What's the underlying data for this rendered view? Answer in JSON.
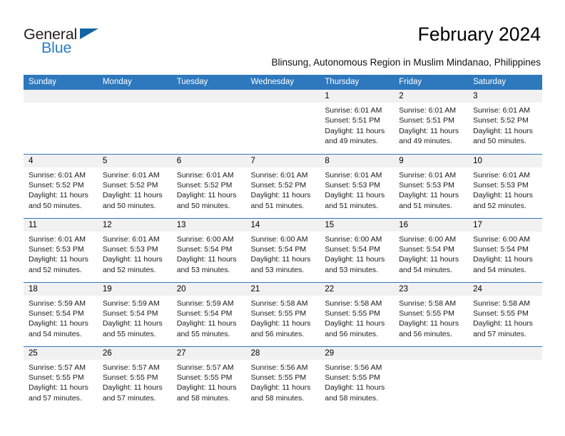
{
  "brand": {
    "logo_top": "General",
    "logo_bottom": "Blue",
    "logo_triangle_icon": "triangle-icon",
    "accent_color": "#2e78bd",
    "logo_blue_color": "#2b7cc4"
  },
  "header": {
    "title": "February 2024",
    "location": "Blinsung, Autonomous Region in Muslim Mindanao, Philippines"
  },
  "weekday_headers": [
    "Sunday",
    "Monday",
    "Tuesday",
    "Wednesday",
    "Thursday",
    "Friday",
    "Saturday"
  ],
  "weeks": [
    [
      {
        "day": "",
        "sunrise": "",
        "sunset": "",
        "daylight_line1": "",
        "daylight_line2": ""
      },
      {
        "day": "",
        "sunrise": "",
        "sunset": "",
        "daylight_line1": "",
        "daylight_line2": ""
      },
      {
        "day": "",
        "sunrise": "",
        "sunset": "",
        "daylight_line1": "",
        "daylight_line2": ""
      },
      {
        "day": "",
        "sunrise": "",
        "sunset": "",
        "daylight_line1": "",
        "daylight_line2": ""
      },
      {
        "day": "1",
        "sunrise": "Sunrise: 6:01 AM",
        "sunset": "Sunset: 5:51 PM",
        "daylight_line1": "Daylight: 11 hours",
        "daylight_line2": "and 49 minutes."
      },
      {
        "day": "2",
        "sunrise": "Sunrise: 6:01 AM",
        "sunset": "Sunset: 5:51 PM",
        "daylight_line1": "Daylight: 11 hours",
        "daylight_line2": "and 49 minutes."
      },
      {
        "day": "3",
        "sunrise": "Sunrise: 6:01 AM",
        "sunset": "Sunset: 5:52 PM",
        "daylight_line1": "Daylight: 11 hours",
        "daylight_line2": "and 50 minutes."
      }
    ],
    [
      {
        "day": "4",
        "sunrise": "Sunrise: 6:01 AM",
        "sunset": "Sunset: 5:52 PM",
        "daylight_line1": "Daylight: 11 hours",
        "daylight_line2": "and 50 minutes."
      },
      {
        "day": "5",
        "sunrise": "Sunrise: 6:01 AM",
        "sunset": "Sunset: 5:52 PM",
        "daylight_line1": "Daylight: 11 hours",
        "daylight_line2": "and 50 minutes."
      },
      {
        "day": "6",
        "sunrise": "Sunrise: 6:01 AM",
        "sunset": "Sunset: 5:52 PM",
        "daylight_line1": "Daylight: 11 hours",
        "daylight_line2": "and 50 minutes."
      },
      {
        "day": "7",
        "sunrise": "Sunrise: 6:01 AM",
        "sunset": "Sunset: 5:52 PM",
        "daylight_line1": "Daylight: 11 hours",
        "daylight_line2": "and 51 minutes."
      },
      {
        "day": "8",
        "sunrise": "Sunrise: 6:01 AM",
        "sunset": "Sunset: 5:53 PM",
        "daylight_line1": "Daylight: 11 hours",
        "daylight_line2": "and 51 minutes."
      },
      {
        "day": "9",
        "sunrise": "Sunrise: 6:01 AM",
        "sunset": "Sunset: 5:53 PM",
        "daylight_line1": "Daylight: 11 hours",
        "daylight_line2": "and 51 minutes."
      },
      {
        "day": "10",
        "sunrise": "Sunrise: 6:01 AM",
        "sunset": "Sunset: 5:53 PM",
        "daylight_line1": "Daylight: 11 hours",
        "daylight_line2": "and 52 minutes."
      }
    ],
    [
      {
        "day": "11",
        "sunrise": "Sunrise: 6:01 AM",
        "sunset": "Sunset: 5:53 PM",
        "daylight_line1": "Daylight: 11 hours",
        "daylight_line2": "and 52 minutes."
      },
      {
        "day": "12",
        "sunrise": "Sunrise: 6:01 AM",
        "sunset": "Sunset: 5:53 PM",
        "daylight_line1": "Daylight: 11 hours",
        "daylight_line2": "and 52 minutes."
      },
      {
        "day": "13",
        "sunrise": "Sunrise: 6:00 AM",
        "sunset": "Sunset: 5:54 PM",
        "daylight_line1": "Daylight: 11 hours",
        "daylight_line2": "and 53 minutes."
      },
      {
        "day": "14",
        "sunrise": "Sunrise: 6:00 AM",
        "sunset": "Sunset: 5:54 PM",
        "daylight_line1": "Daylight: 11 hours",
        "daylight_line2": "and 53 minutes."
      },
      {
        "day": "15",
        "sunrise": "Sunrise: 6:00 AM",
        "sunset": "Sunset: 5:54 PM",
        "daylight_line1": "Daylight: 11 hours",
        "daylight_line2": "and 53 minutes."
      },
      {
        "day": "16",
        "sunrise": "Sunrise: 6:00 AM",
        "sunset": "Sunset: 5:54 PM",
        "daylight_line1": "Daylight: 11 hours",
        "daylight_line2": "and 54 minutes."
      },
      {
        "day": "17",
        "sunrise": "Sunrise: 6:00 AM",
        "sunset": "Sunset: 5:54 PM",
        "daylight_line1": "Daylight: 11 hours",
        "daylight_line2": "and 54 minutes."
      }
    ],
    [
      {
        "day": "18",
        "sunrise": "Sunrise: 5:59 AM",
        "sunset": "Sunset: 5:54 PM",
        "daylight_line1": "Daylight: 11 hours",
        "daylight_line2": "and 54 minutes."
      },
      {
        "day": "19",
        "sunrise": "Sunrise: 5:59 AM",
        "sunset": "Sunset: 5:54 PM",
        "daylight_line1": "Daylight: 11 hours",
        "daylight_line2": "and 55 minutes."
      },
      {
        "day": "20",
        "sunrise": "Sunrise: 5:59 AM",
        "sunset": "Sunset: 5:54 PM",
        "daylight_line1": "Daylight: 11 hours",
        "daylight_line2": "and 55 minutes."
      },
      {
        "day": "21",
        "sunrise": "Sunrise: 5:58 AM",
        "sunset": "Sunset: 5:55 PM",
        "daylight_line1": "Daylight: 11 hours",
        "daylight_line2": "and 56 minutes."
      },
      {
        "day": "22",
        "sunrise": "Sunrise: 5:58 AM",
        "sunset": "Sunset: 5:55 PM",
        "daylight_line1": "Daylight: 11 hours",
        "daylight_line2": "and 56 minutes."
      },
      {
        "day": "23",
        "sunrise": "Sunrise: 5:58 AM",
        "sunset": "Sunset: 5:55 PM",
        "daylight_line1": "Daylight: 11 hours",
        "daylight_line2": "and 56 minutes."
      },
      {
        "day": "24",
        "sunrise": "Sunrise: 5:58 AM",
        "sunset": "Sunset: 5:55 PM",
        "daylight_line1": "Daylight: 11 hours",
        "daylight_line2": "and 57 minutes."
      }
    ],
    [
      {
        "day": "25",
        "sunrise": "Sunrise: 5:57 AM",
        "sunset": "Sunset: 5:55 PM",
        "daylight_line1": "Daylight: 11 hours",
        "daylight_line2": "and 57 minutes."
      },
      {
        "day": "26",
        "sunrise": "Sunrise: 5:57 AM",
        "sunset": "Sunset: 5:55 PM",
        "daylight_line1": "Daylight: 11 hours",
        "daylight_line2": "and 57 minutes."
      },
      {
        "day": "27",
        "sunrise": "Sunrise: 5:57 AM",
        "sunset": "Sunset: 5:55 PM",
        "daylight_line1": "Daylight: 11 hours",
        "daylight_line2": "and 58 minutes."
      },
      {
        "day": "28",
        "sunrise": "Sunrise: 5:56 AM",
        "sunset": "Sunset: 5:55 PM",
        "daylight_line1": "Daylight: 11 hours",
        "daylight_line2": "and 58 minutes."
      },
      {
        "day": "29",
        "sunrise": "Sunrise: 5:56 AM",
        "sunset": "Sunset: 5:55 PM",
        "daylight_line1": "Daylight: 11 hours",
        "daylight_line2": "and 58 minutes."
      },
      {
        "day": "",
        "sunrise": "",
        "sunset": "",
        "daylight_line1": "",
        "daylight_line2": ""
      },
      {
        "day": "",
        "sunrise": "",
        "sunset": "",
        "daylight_line1": "",
        "daylight_line2": ""
      }
    ]
  ]
}
